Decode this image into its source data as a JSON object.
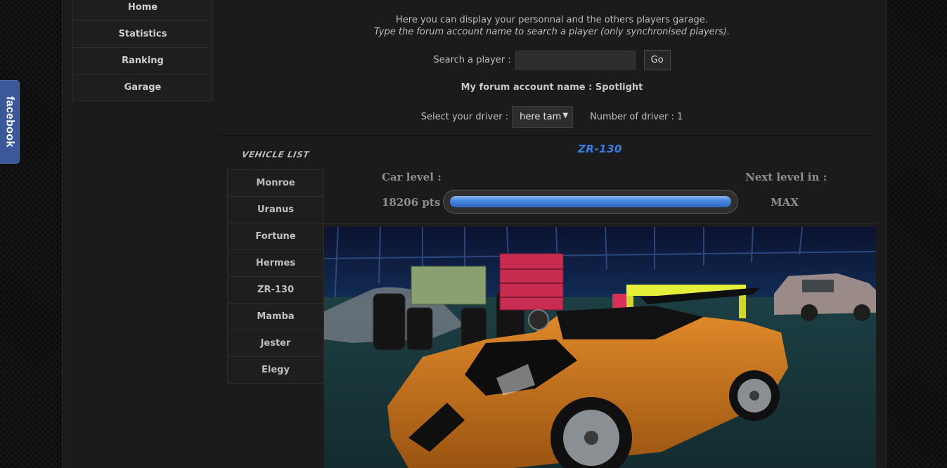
{
  "facebook_tab": {
    "label": "facebook"
  },
  "nav": {
    "items": [
      {
        "label": "Home"
      },
      {
        "label": "Statistics"
      },
      {
        "label": "Ranking"
      },
      {
        "label": "Garage"
      }
    ]
  },
  "intro": {
    "line1": "Here you can display your personnal and the others players garage.",
    "line2": "Type the forum account name to search a player (only synchronised players)."
  },
  "search": {
    "label": "Search a player :",
    "value": "",
    "placeholder": "",
    "button_label": "Go"
  },
  "account": {
    "text": "My forum account name : Spotlight"
  },
  "driver": {
    "label": "Select your driver :",
    "selected": "here tam",
    "count_text": "Number of driver : 1"
  },
  "vehicles": {
    "title": "VEHICLE LIST",
    "items": [
      {
        "label": "Monroe"
      },
      {
        "label": "Uranus"
      },
      {
        "label": "Fortune"
      },
      {
        "label": "Hermes"
      },
      {
        "label": "ZR-130"
      },
      {
        "label": "Mamba"
      },
      {
        "label": "Jester"
      },
      {
        "label": "Elegy"
      }
    ]
  },
  "car": {
    "name": "ZR-130",
    "level_label": "Car level :",
    "next_level_label": "Next level in :",
    "points": "18206 pts",
    "next_level_value": "MAX",
    "progress": 1.0,
    "accent_color": "#3d7ad8"
  },
  "colors": {
    "background": "#111111",
    "panel": "#1b1b1b",
    "facebook": "#3b5998"
  }
}
